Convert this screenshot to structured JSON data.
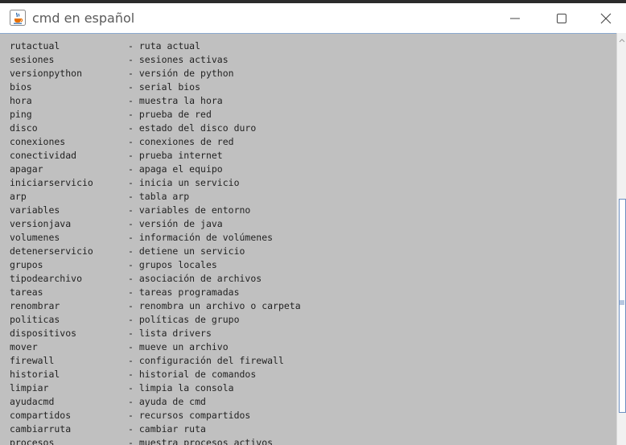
{
  "window": {
    "title": "cmd en español",
    "app_icon": "java-cup-icon"
  },
  "colors": {
    "console_bg": "#c0c0c0",
    "titlebar_bg": "#ffffff",
    "text": "#222222",
    "accent": "#6d8fc1"
  },
  "console": {
    "separator": "-",
    "lines": [
      {
        "cmd": "",
        "desc": ""
      },
      {
        "cmd": "rutactual",
        "desc": "ruta actual"
      },
      {
        "cmd": "sesiones",
        "desc": "sesiones activas"
      },
      {
        "cmd": "versionpython",
        "desc": "versión de python"
      },
      {
        "cmd": "bios",
        "desc": "serial bios"
      },
      {
        "cmd": "hora",
        "desc": "muestra la hora"
      },
      {
        "cmd": "ping",
        "desc": "prueba de red"
      },
      {
        "cmd": "disco",
        "desc": "estado del disco duro"
      },
      {
        "cmd": "conexiones",
        "desc": "conexiones de red"
      },
      {
        "cmd": "conectividad",
        "desc": "prueba internet"
      },
      {
        "cmd": "apagar",
        "desc": "apaga el equipo"
      },
      {
        "cmd": "iniciarservicio",
        "desc": "inicia un servicio"
      },
      {
        "cmd": "arp",
        "desc": "tabla arp"
      },
      {
        "cmd": "variables",
        "desc": "variables de entorno"
      },
      {
        "cmd": "versionjava",
        "desc": "versión de java"
      },
      {
        "cmd": "volumenes",
        "desc": "información de volúmenes"
      },
      {
        "cmd": "detenerservicio",
        "desc": "detiene un servicio"
      },
      {
        "cmd": "grupos",
        "desc": "grupos locales"
      },
      {
        "cmd": "tipodearchivo",
        "desc": "asociación de archivos"
      },
      {
        "cmd": "tareas",
        "desc": "tareas programadas"
      },
      {
        "cmd": "renombrar",
        "desc": "renombra un archivo o carpeta"
      },
      {
        "cmd": "politicas",
        "desc": "políticas de grupo"
      },
      {
        "cmd": "dispositivos",
        "desc": "lista drivers"
      },
      {
        "cmd": "mover",
        "desc": "mueve un archivo"
      },
      {
        "cmd": "firewall",
        "desc": "configuración del firewall"
      },
      {
        "cmd": "historial",
        "desc": "historial de comandos"
      },
      {
        "cmd": "limpiar",
        "desc": "limpia la consola"
      },
      {
        "cmd": "ayudacmd",
        "desc": "ayuda de cmd"
      },
      {
        "cmd": "compartidos",
        "desc": "recursos compartidos"
      },
      {
        "cmd": "cambiarruta",
        "desc": "cambiar ruta"
      },
      {
        "cmd": "procesos",
        "desc": "muestra procesos activos"
      }
    ]
  }
}
